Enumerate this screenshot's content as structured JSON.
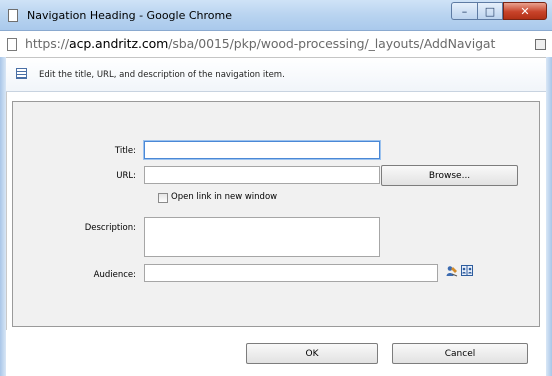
{
  "window": {
    "title": "Navigation Heading - Google Chrome",
    "minimize_glyph": "–",
    "maximize_glyph": "□",
    "close_glyph": "✕"
  },
  "address": {
    "prefix": "https://",
    "domain": "acp.andritz.com",
    "path": "/sba/0015/pkp/wood-processing/_layouts/AddNavigat"
  },
  "description": "Edit the title, URL, and description of the navigation item.",
  "form": {
    "title_label": "Title:",
    "title_value": "",
    "url_label": "URL:",
    "url_value": "",
    "browse_label": "Browse...",
    "new_window_label": "Open link in new window",
    "new_window_checked": false,
    "description_label": "Description:",
    "description_value": "",
    "audience_label": "Audience:",
    "audience_value": ""
  },
  "footer": {
    "ok_label": "OK",
    "cancel_label": "Cancel"
  },
  "icons": {
    "page": "page-icon",
    "list": "list-icon",
    "people_picker": "people-picker-icon",
    "address_book": "address-book-icon",
    "translate": "translate-icon"
  },
  "colors": {
    "titlebar": "#b9d4f0",
    "close_button": "#c8432a",
    "form_background": "#f1f1f1",
    "focus_border": "#4a88d6"
  }
}
